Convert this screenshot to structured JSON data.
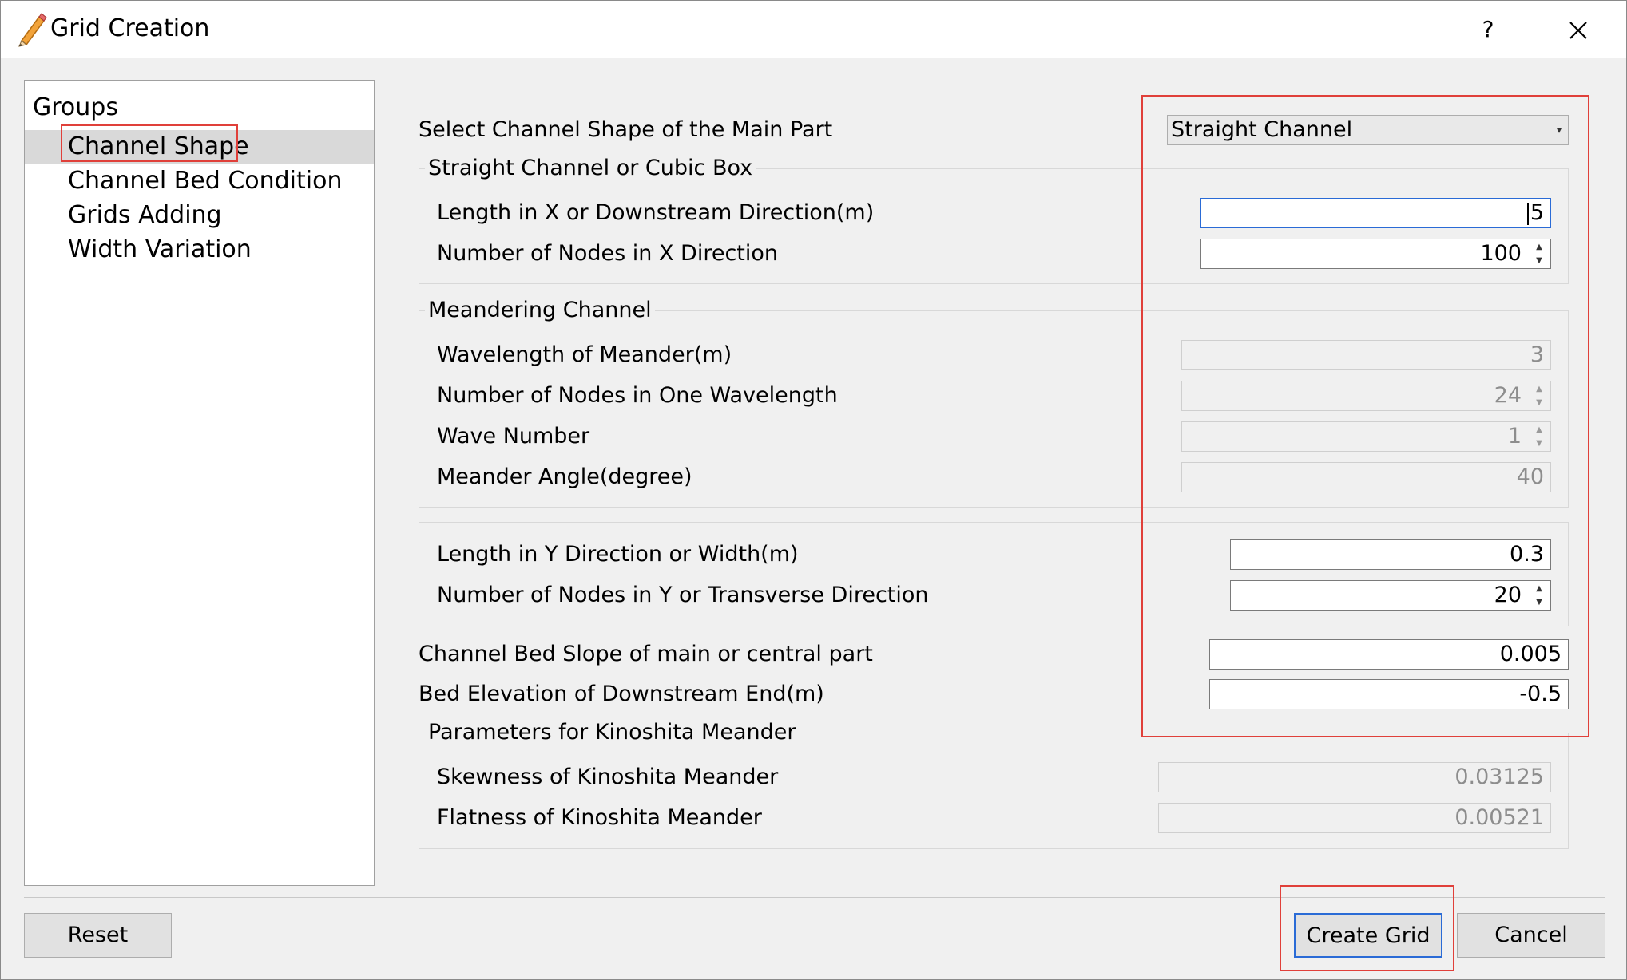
{
  "window": {
    "title": "Grid Creation",
    "help_label": "?",
    "icon": "pencil-icon"
  },
  "groups": {
    "header": "Groups",
    "items": [
      {
        "label": "Channel Shape",
        "selected": true
      },
      {
        "label": "Channel Bed Condition",
        "selected": false
      },
      {
        "label": "Grids Adding",
        "selected": false
      },
      {
        "label": "Width Variation",
        "selected": false
      }
    ]
  },
  "main": {
    "channel_shape_label": "Select Channel Shape of the Main Part",
    "channel_shape_value": "Straight Channel",
    "straight_box": {
      "title": "Straight Channel or Cubic Box",
      "length_x_label": "Length in X or Downstream Direction(m)",
      "length_x_value": "5",
      "nodes_x_label": "Number of Nodes in X Direction",
      "nodes_x_value": "100"
    },
    "meander_box": {
      "title": "Meandering Channel",
      "wavelength_label": "Wavelength of Meander(m)",
      "wavelength_value": "3",
      "nodes_wavelength_label": "Number of Nodes in One Wavelength",
      "nodes_wavelength_value": "24",
      "wave_number_label": "Wave Number",
      "wave_number_value": "1",
      "angle_label": "Meander Angle(degree)",
      "angle_value": "40"
    },
    "width_box": {
      "length_y_label": "Length in Y Direction or Width(m)",
      "length_y_value": "0.3",
      "nodes_y_label": "Number of Nodes in Y or Transverse Direction",
      "nodes_y_value": "20"
    },
    "bed_slope_label": "Channel Bed Slope of main or central part",
    "bed_slope_value": "0.005",
    "bed_elevation_label": "Bed Elevation of Downstream End(m)",
    "bed_elevation_value": "-0.5",
    "kinoshita_box": {
      "title": "Parameters for Kinoshita Meander",
      "skewness_label": "Skewness of Kinoshita Meander",
      "skewness_value": "0.03125",
      "flatness_label": "Flatness of Kinoshita Meander",
      "flatness_value": "0.00521"
    }
  },
  "buttons": {
    "reset": "Reset",
    "create_grid": "Create Grid",
    "cancel": "Cancel"
  },
  "colors": {
    "highlight": "#e0403a",
    "focus": "#2a6bd6",
    "selection": "#d9d9d9"
  }
}
